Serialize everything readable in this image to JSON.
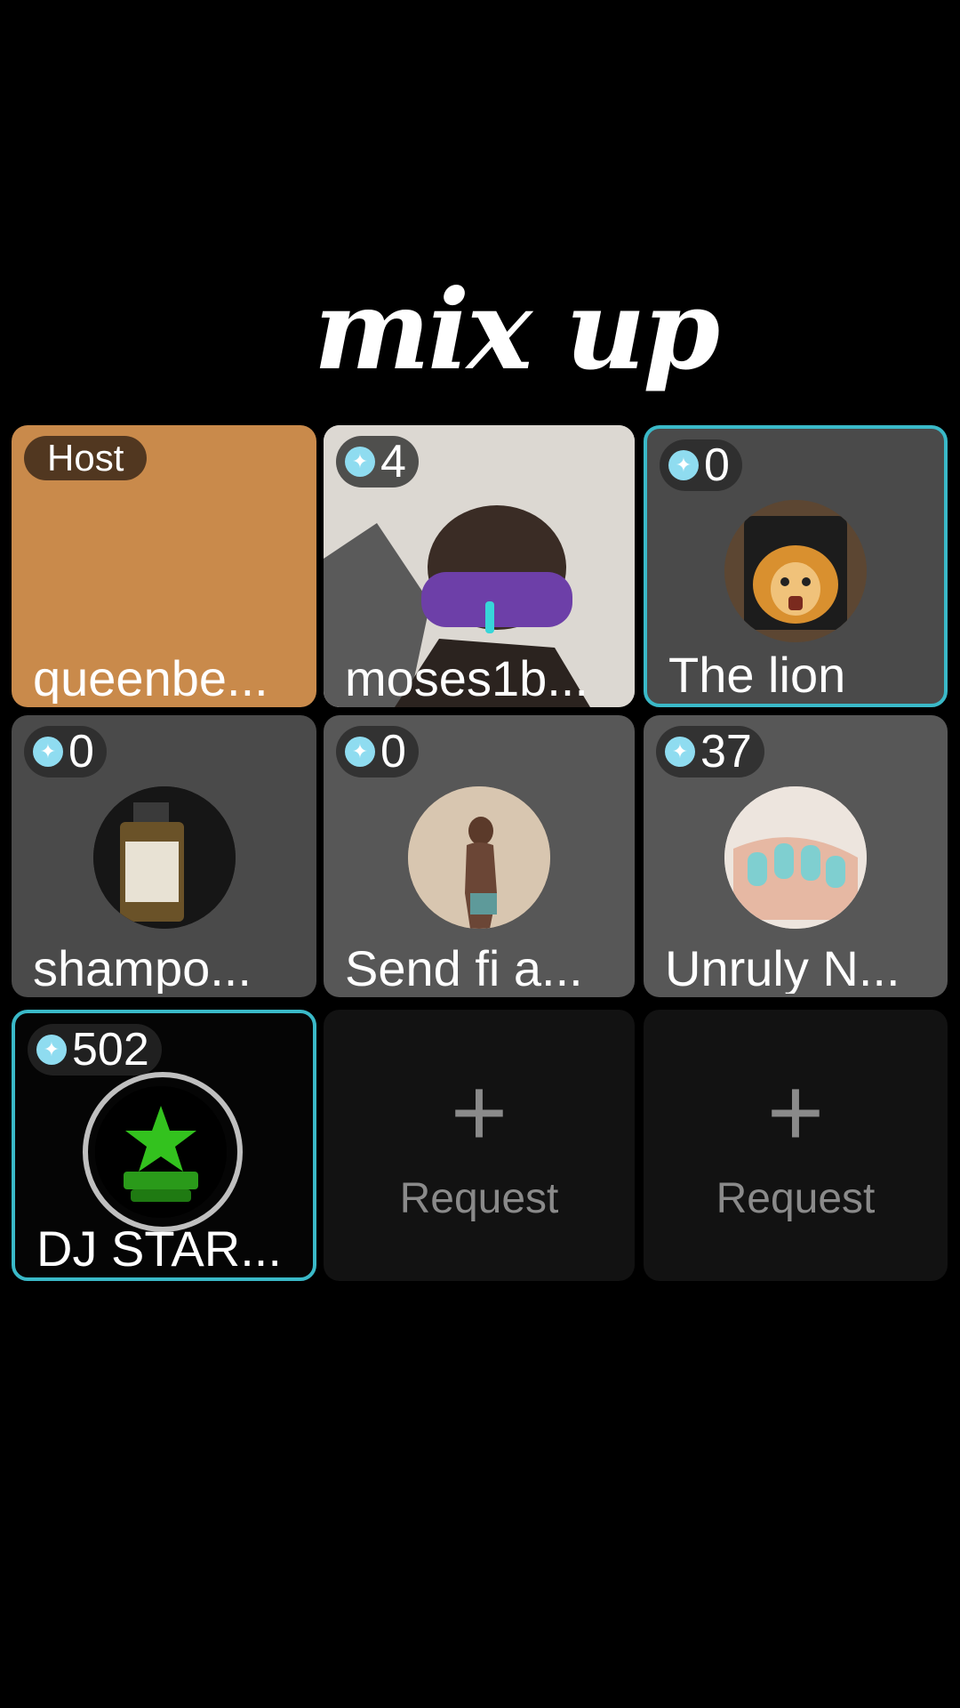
{
  "header": {
    "title": "mix up"
  },
  "tiles": [
    {
      "kind": "host",
      "badge": "Host",
      "name": "queenbe..."
    },
    {
      "kind": "user",
      "count": "4",
      "name": "moses1b..."
    },
    {
      "kind": "user",
      "count": "0",
      "name": "The lion"
    },
    {
      "kind": "user",
      "count": "0",
      "name": "shampo..."
    },
    {
      "kind": "user",
      "count": "0",
      "name": "Send fi a..."
    },
    {
      "kind": "user",
      "count": "37",
      "name": "Unruly N..."
    },
    {
      "kind": "user",
      "count": "502",
      "name": "DJ STAR..."
    },
    {
      "kind": "request",
      "label": "Request",
      "icon": "plus-icon"
    },
    {
      "kind": "request",
      "label": "Request",
      "icon": "plus-icon"
    }
  ],
  "colors": {
    "accent": "#3ab9c8",
    "host": "#c98a4b",
    "gem": "#8fdcf0"
  }
}
